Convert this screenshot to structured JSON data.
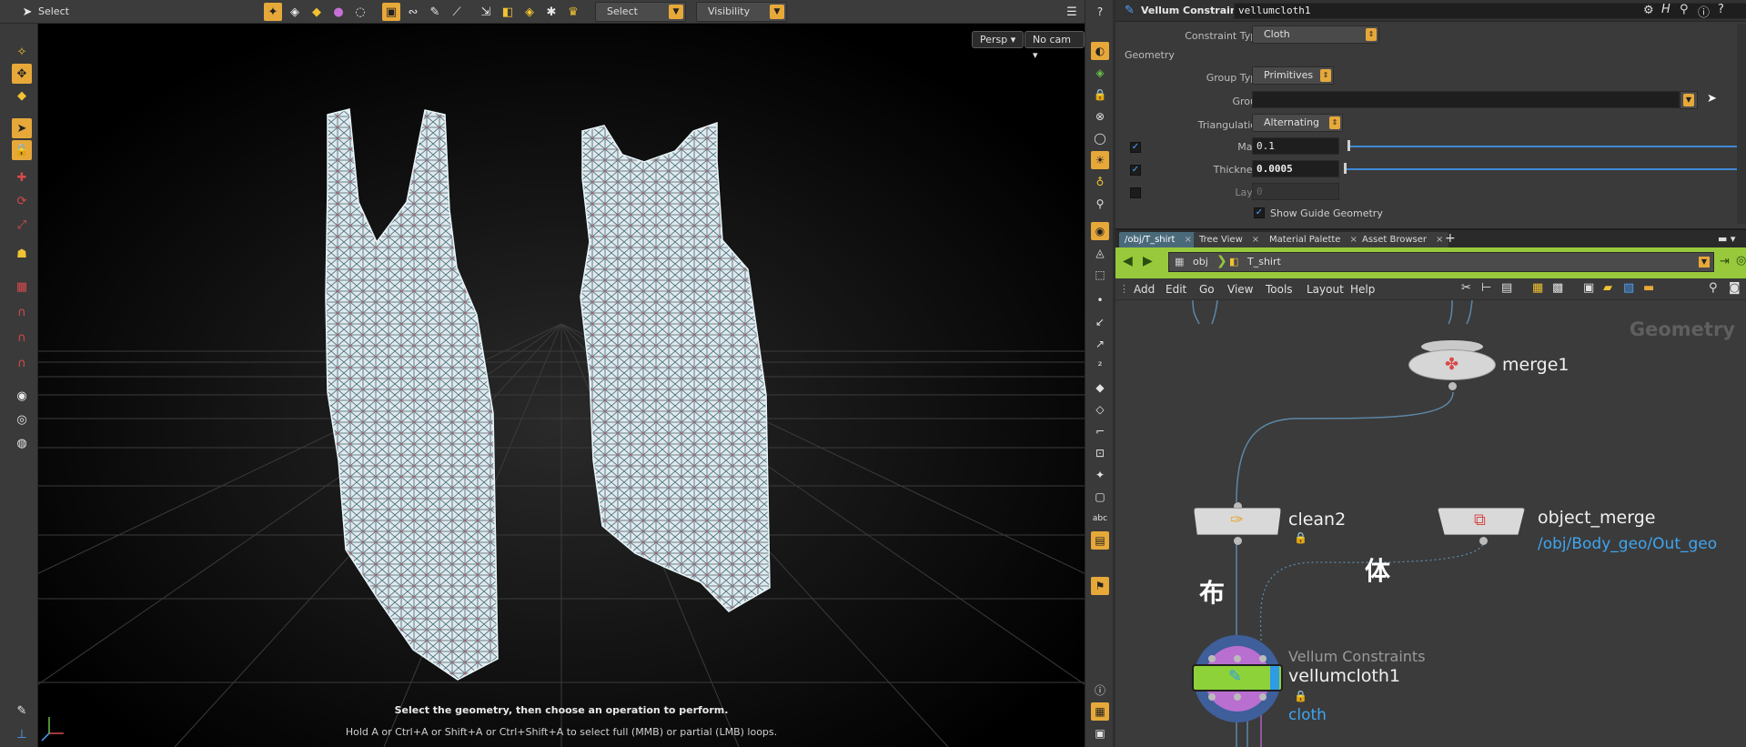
{
  "viewport_toolbar": {
    "mode_label": "Select",
    "select_dropdown": "Select",
    "visibility_dropdown": "Visibility"
  },
  "viewport": {
    "camera_view": "Persp",
    "camera": "No cam",
    "message_primary": "Select the geometry, then choose an operation to perform.",
    "message_secondary": "Hold A or Ctrl+A or Shift+A or Ctrl+Shift+A to select full (MMB) or partial (LMB) loops."
  },
  "parameters": {
    "node_type": "Vellum Constraints",
    "node_name": "vellumcloth1",
    "constraint_type_label": "Constraint Type",
    "constraint_type": "Cloth",
    "section": "Geometry",
    "group_type_label": "Group Type",
    "group_type": "Primitives",
    "group_label": "Group",
    "group_value": "",
    "triangulation_label": "Triangulation",
    "triangulation": "Alternating",
    "mass_label": "Mass",
    "mass": "0.1",
    "mass_enabled": true,
    "thickness_label": "Thickness",
    "thickness": "0.0005",
    "thickness_enabled": true,
    "layer_label": "Layer",
    "layer": "0",
    "layer_enabled": false,
    "show_guide_label": "Show Guide Geometry",
    "show_guide": true
  },
  "network": {
    "tabs": [
      {
        "label": "/obj/T_shirt"
      },
      {
        "label": "Tree View"
      },
      {
        "label": "Material Palette"
      },
      {
        "label": "Asset Browser"
      }
    ],
    "path_root": "obj",
    "path_current": "T_shirt",
    "menu": [
      "Add",
      "Edit",
      "Go",
      "View",
      "Tools",
      "Layout",
      "Help"
    ],
    "context_label": "Geometry",
    "nodes": {
      "merge": {
        "name": "merge1"
      },
      "clean": {
        "name": "clean2"
      },
      "object_merge": {
        "name": "object_merge",
        "sub": "/obj/Body_geo/Out_geo"
      },
      "vellum": {
        "comment": "Vellum Constraints",
        "name": "vellumcloth1",
        "sub": "cloth"
      }
    },
    "annotation_cloth": "布",
    "annotation_body": "体"
  },
  "colors": {
    "accent": "#e7a83a",
    "path_bar": "#98c93c",
    "link_blue": "#3fa5f0",
    "slider_blue": "#3f8ad6",
    "vellum_node": "#8ed23a"
  }
}
